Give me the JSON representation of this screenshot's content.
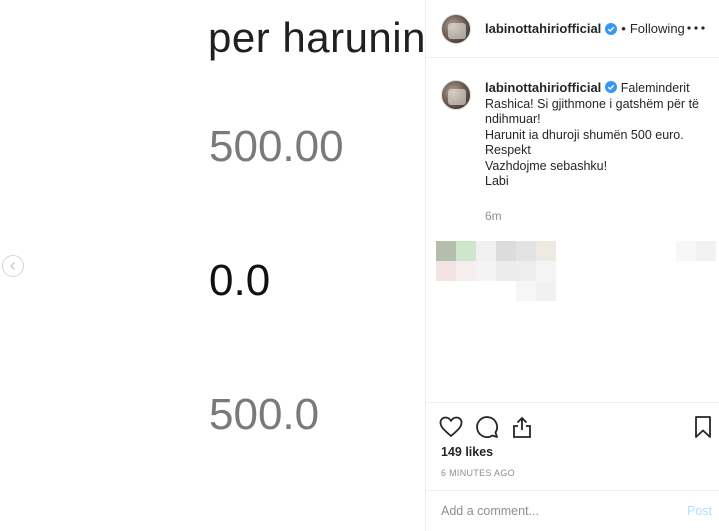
{
  "media": {
    "title_text": "per harunin",
    "value_1": "500.00",
    "value_2": "0.0",
    "value_3": "500.0",
    "prev_icon": "chevron-left-icon"
  },
  "header": {
    "username": "labinottahiriofficial",
    "separator": "•",
    "follow_status": "Following",
    "verified_icon": "verified-badge-icon",
    "more_icon": "more-options-icon"
  },
  "caption": {
    "username": "labinottahiriofficial",
    "lines": [
      "Faleminderit",
      "Rashica! Si gjithmone i gatshëm për të",
      "ndihmuar!",
      "Harunit ia dhuroji shumën 500 euro.",
      "Respekt",
      "Vazhdojme sebashku!",
      "Labi"
    ],
    "time": "6m"
  },
  "actions": {
    "like_icon": "heart-icon",
    "comment_icon": "comment-icon",
    "share_icon": "share-icon",
    "save_icon": "bookmark-icon",
    "likes": "149 likes",
    "posted_ago": "6 MINUTES AGO"
  },
  "comment_box": {
    "placeholder": "Add a comment...",
    "post_label": "Post"
  },
  "colors": {
    "verified": "#3897f0",
    "post_disabled": "#b2dffc",
    "muted": "#8e8e8e",
    "text": "#262626"
  }
}
